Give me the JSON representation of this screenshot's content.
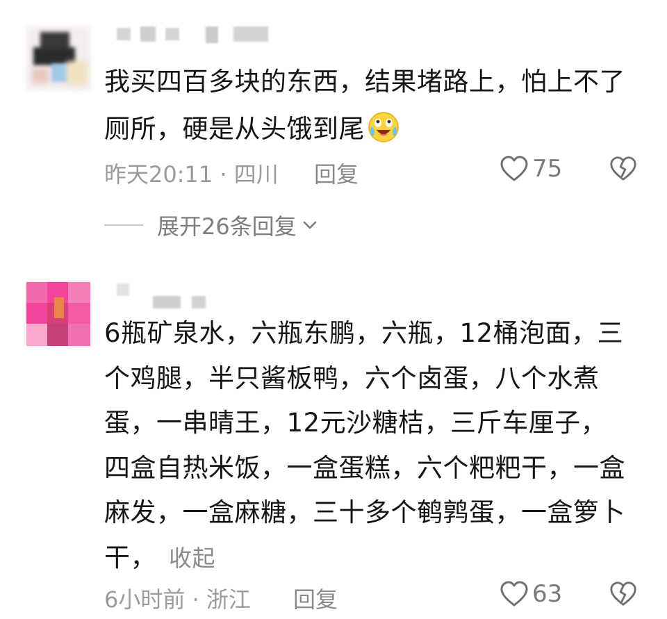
{
  "comments": [
    {
      "text": "我买四百多块的东西，结果堵路上，怕上不了厕所，硬是从头饿到尾",
      "emoji_icon": "grinning-tears-emoji",
      "time_location": "昨天20:11 · 四川",
      "reply_label": "回复",
      "like_count": "75",
      "expand_replies_label": "展开26条回复"
    },
    {
      "text": "6瓶矿泉水，六瓶东鹏，六瓶，12桶泡面，三个鸡腿，半只酱板鸭，六个卤蛋，八个水煮蛋，一串晴王，12元沙糖桔，三斤车厘子，四盒自热米饭，一盒蛋糕，六个粑粑干，一盒麻发，一盒麻糖，三十多个鹌鹑蛋，一盒箩卜干，",
      "collapse_label": "收起",
      "time_location": "6小时前 · 浙江",
      "reply_label": "回复",
      "like_count": "63"
    }
  ],
  "icons": {
    "like": "heart-outline-icon",
    "dislike": "broken-heart-icon",
    "expand": "chevron-down-icon"
  },
  "colors": {
    "text": "#161616",
    "meta": "#9b9b9b",
    "icon": "#6f6f6f",
    "avatar2_accent": "#f2449a"
  }
}
